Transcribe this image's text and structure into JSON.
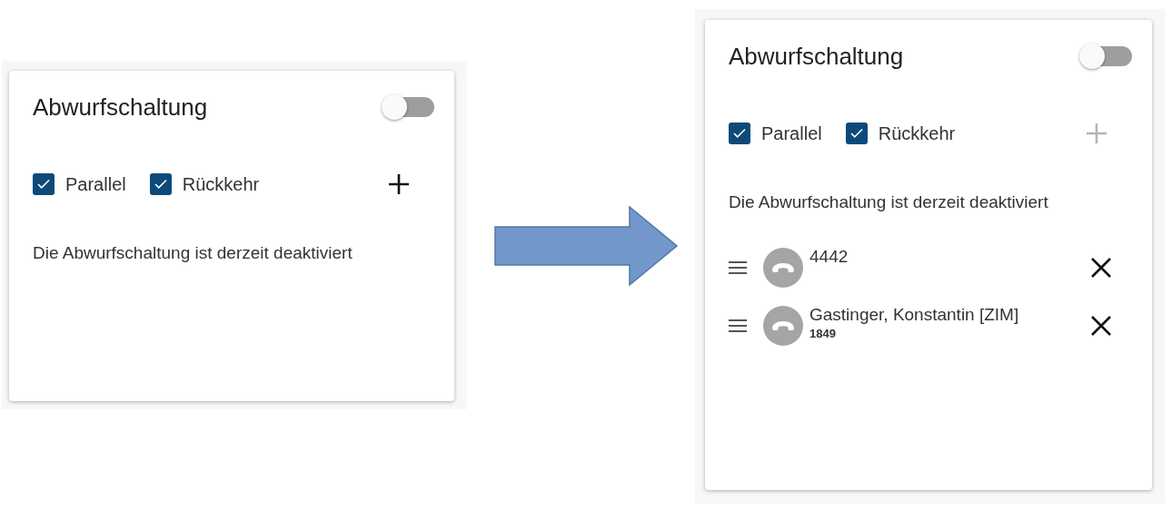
{
  "panels": [
    {
      "title": "Abwurfschaltung",
      "switch_on": false,
      "checkboxes": [
        {
          "label": "Parallel",
          "checked": true
        },
        {
          "label": "Rückkehr",
          "checked": true
        }
      ],
      "add_disabled": false,
      "message": "Die Abwurfschaltung ist derzeit deaktiviert"
    },
    {
      "title": "Abwurfschaltung",
      "switch_on": false,
      "checkboxes": [
        {
          "label": "Parallel",
          "checked": true
        },
        {
          "label": "Rückkehr",
          "checked": true
        }
      ],
      "add_disabled": true,
      "message": "Die Abwurfschaltung ist derzeit deaktiviert",
      "entries": [
        {
          "name": "4442"
        },
        {
          "name": "Gastinger, Konstantin [ZIM]",
          "number": "1849"
        }
      ]
    }
  ]
}
